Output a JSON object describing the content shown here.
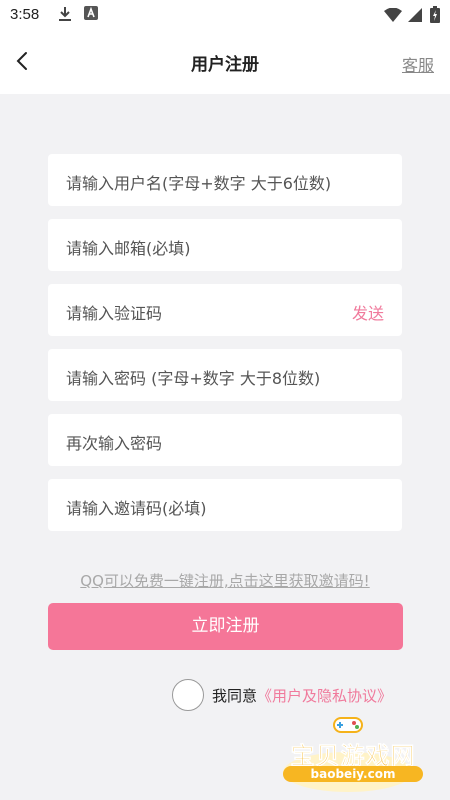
{
  "status_bar": {
    "time": "3:58"
  },
  "header": {
    "title": "用户注册",
    "service_label": "客服"
  },
  "form": {
    "username_placeholder": "请输入用户名(字母+数字 大于6位数)",
    "email_placeholder": "请输入邮箱(必填)",
    "code_placeholder": "请输入验证码",
    "send_label": "发送",
    "password_placeholder": "请输入密码 (字母+数字 大于8位数)",
    "confirm_placeholder": "再次输入密码",
    "invite_placeholder": "请输入邀请码(必填)"
  },
  "qq_link": "QQ可以免费一键注册,点击这里获取邀请码!",
  "register_label": "立即注册",
  "agreement": {
    "prefix": "我同意",
    "link": "《用户及隐私协议》"
  },
  "watermark": {
    "text": "宝贝游戏网",
    "url": "baobeiy.com"
  },
  "colors": {
    "accent": "#f57698",
    "link_pink": "#f07a9c",
    "background": "#f2f2f4"
  }
}
